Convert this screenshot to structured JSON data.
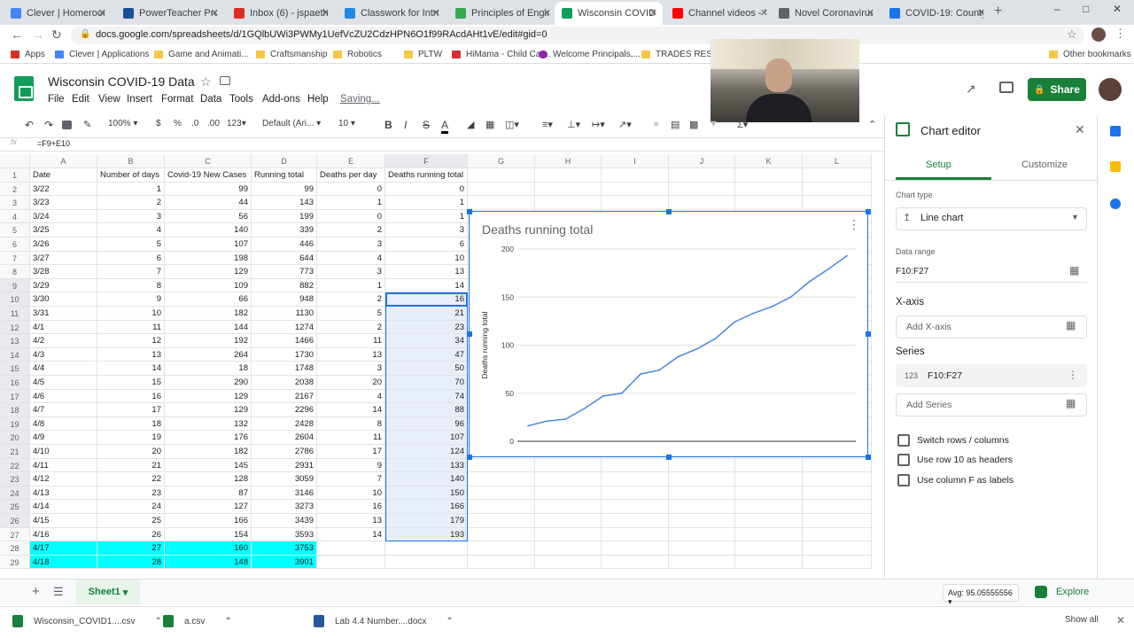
{
  "browser": {
    "tabs": [
      {
        "label": "Clever | Homeroom",
        "color": "#4285f4"
      },
      {
        "label": "PowerTeacher Pro",
        "color": "#1a4e9a"
      },
      {
        "label": "Inbox (6) - jspaeth",
        "color": "#d93025"
      },
      {
        "label": "Classwork for Intro",
        "color": "#1e88e5"
      },
      {
        "label": "Principles of Engin",
        "color": "#34a853"
      },
      {
        "label": "Wisconsin COVID-",
        "color": "#0f9d58"
      },
      {
        "label": "Channel videos - Y",
        "color": "#ff0000"
      },
      {
        "label": "Novel Coronavirus",
        "color": "#5f6368"
      },
      {
        "label": "COVID-19: County",
        "color": "#1a73e8"
      }
    ],
    "url": "docs.google.com/spreadsheets/d/1GQlbUWi3PWMy1UefVcZU2CdzHPN6O1f99RAcdAHt1vE/edit#gid=0",
    "bookmarks": [
      "Apps",
      "Clever | Applications",
      "Game and Animati...",
      "Craftsmanship",
      "Robotics",
      "PLTW",
      "HiMama - Child Car...",
      "Welcome Principals,...",
      "TRADES RESOU"
    ],
    "other_bookmarks": "Other bookmarks"
  },
  "sheet": {
    "title": "Wisconsin COVID-19 Data",
    "menus": [
      "File",
      "Edit",
      "View",
      "Insert",
      "Format",
      "Data",
      "Tools",
      "Add-ons",
      "Help"
    ],
    "saving": "Saving...",
    "share": "Share",
    "toolbar": {
      "zoom": "100%",
      "currency": "$",
      "percent": "%",
      "dec1": ".0",
      "dec2": ".00",
      "fmt": "123",
      "font": "Default (Ari...",
      "size": "10",
      "bold": "B",
      "italic": "I",
      "strike": "S",
      "textcolor": "A"
    },
    "formula": "=F9+E10",
    "columns": [
      "A",
      "B",
      "C",
      "D",
      "E",
      "F",
      "G",
      "H",
      "I",
      "J",
      "K",
      "L"
    ],
    "headers": [
      "Date",
      "Number of days",
      "Covid-19 New Cases",
      "Running total",
      "Deaths per day",
      "Deaths running total"
    ],
    "rows": [
      [
        "3/22",
        "1",
        "99",
        "99",
        "0",
        "0"
      ],
      [
        "3/23",
        "2",
        "44",
        "143",
        "1",
        "1"
      ],
      [
        "3/24",
        "3",
        "56",
        "199",
        "0",
        "1"
      ],
      [
        "3/25",
        "4",
        "140",
        "339",
        "2",
        "3"
      ],
      [
        "3/26",
        "5",
        "107",
        "446",
        "3",
        "6"
      ],
      [
        "3/27",
        "6",
        "198",
        "644",
        "4",
        "10"
      ],
      [
        "3/28",
        "7",
        "129",
        "773",
        "3",
        "13"
      ],
      [
        "3/29",
        "8",
        "109",
        "882",
        "1",
        "14"
      ],
      [
        "3/30",
        "9",
        "66",
        "948",
        "2",
        "16"
      ],
      [
        "3/31",
        "10",
        "182",
        "1130",
        "5",
        "21"
      ],
      [
        "4/1",
        "11",
        "144",
        "1274",
        "2",
        "23"
      ],
      [
        "4/2",
        "12",
        "192",
        "1466",
        "11",
        "34"
      ],
      [
        "4/3",
        "13",
        "264",
        "1730",
        "13",
        "47"
      ],
      [
        "4/4",
        "14",
        "18",
        "1748",
        "3",
        "50"
      ],
      [
        "4/5",
        "15",
        "290",
        "2038",
        "20",
        "70"
      ],
      [
        "4/6",
        "16",
        "129",
        "2167",
        "4",
        "74"
      ],
      [
        "4/7",
        "17",
        "129",
        "2296",
        "14",
        "88"
      ],
      [
        "4/8",
        "18",
        "132",
        "2428",
        "8",
        "96"
      ],
      [
        "4/9",
        "19",
        "176",
        "2604",
        "11",
        "107"
      ],
      [
        "4/10",
        "20",
        "182",
        "2786",
        "17",
        "124"
      ],
      [
        "4/11",
        "21",
        "145",
        "2931",
        "9",
        "133"
      ],
      [
        "4/12",
        "22",
        "128",
        "3059",
        "7",
        "140"
      ],
      [
        "4/13",
        "23",
        "87",
        "3146",
        "10",
        "150"
      ],
      [
        "4/14",
        "24",
        "127",
        "3273",
        "16",
        "166"
      ],
      [
        "4/15",
        "25",
        "166",
        "3439",
        "13",
        "179"
      ],
      [
        "4/16",
        "26",
        "154",
        "3593",
        "14",
        "193"
      ],
      [
        "4/17",
        "27",
        "160",
        "3753",
        "",
        ""
      ],
      [
        "4/18",
        "28",
        "148",
        "3901",
        "",
        ""
      ]
    ],
    "sheet_tab": "Sheet1",
    "status": "Avg: 95.05555556",
    "explore": "Explore"
  },
  "chart_data": {
    "type": "line",
    "title": "Deaths running total",
    "ylabel": "Deaths running total",
    "xlabel": "",
    "ylim": [
      0,
      200
    ],
    "yticks": [
      0,
      50,
      100,
      150,
      200
    ],
    "grid": true,
    "series": [
      {
        "values": [
          16,
          21,
          23,
          34,
          47,
          50,
          70,
          74,
          88,
          96,
          107,
          124,
          133,
          140,
          150,
          166,
          179,
          193
        ],
        "color": "#4a86d9"
      }
    ]
  },
  "editor": {
    "title": "Chart editor",
    "tabs": [
      "Setup",
      "Customize"
    ],
    "chart_type_label": "Chart type",
    "chart_type": "Line chart",
    "data_range_label": "Data range",
    "data_range": "F10:F27",
    "xaxis_label": "X-axis",
    "add_xaxis": "Add X-axis",
    "series_label": "Series",
    "series_value": "F10:F27",
    "series_icon_text": "123",
    "add_series": "Add Series",
    "checkboxes": [
      "Switch rows / columns",
      "Use row 10 as headers",
      "Use column F as labels"
    ]
  },
  "downloads": [
    {
      "name": "Wisconsin_COVID1....csv",
      "color": "#188038"
    },
    {
      "name": "a.csv",
      "color": "#188038"
    },
    {
      "name": "Lab 4.4 Number....docx",
      "color": "#2b579a"
    }
  ],
  "show_all": "Show all"
}
